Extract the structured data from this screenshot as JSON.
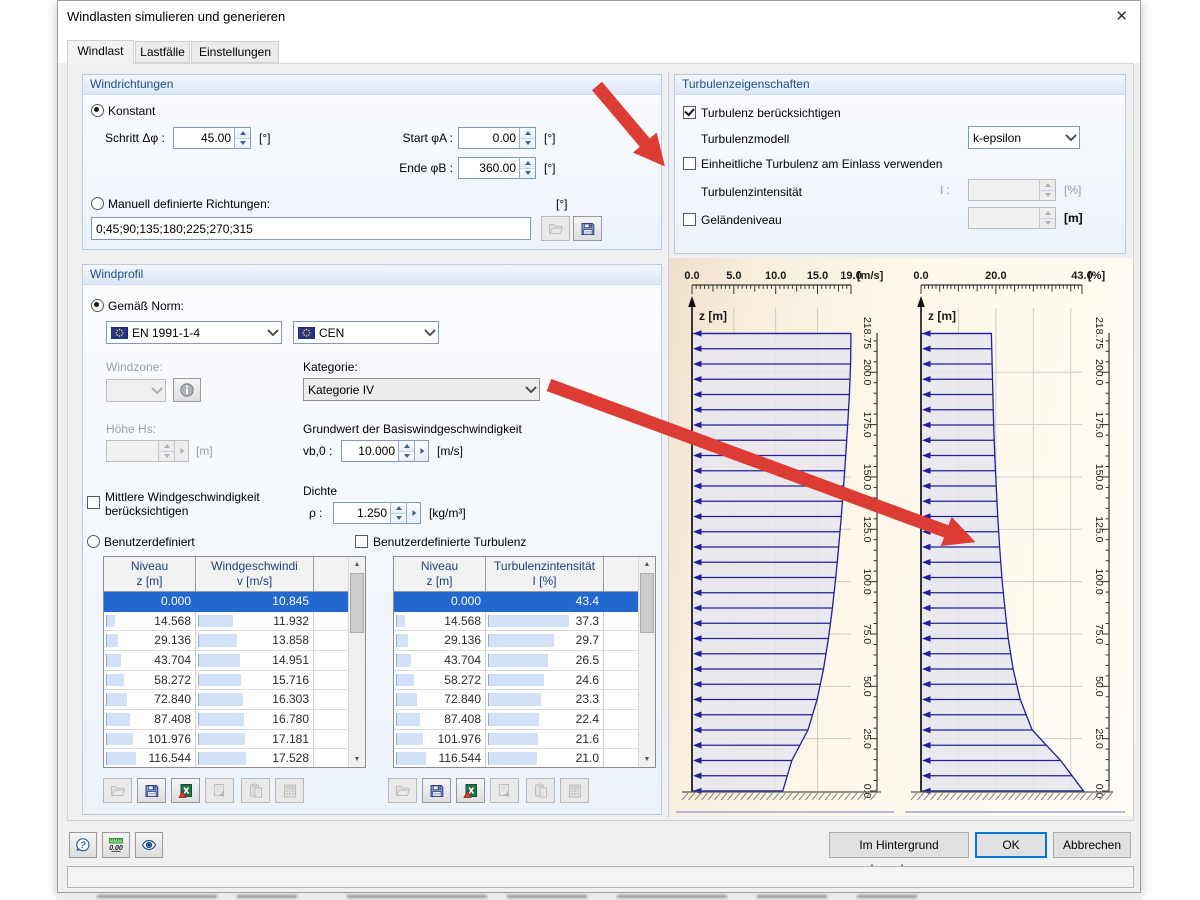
{
  "window": {
    "title": "Windlasten simulieren und generieren",
    "close_glyph": "✕"
  },
  "tabs": [
    {
      "label": "Windlast"
    },
    {
      "label": "Lastfälle"
    },
    {
      "label": "Einstellungen"
    }
  ],
  "wind_directions": {
    "title": "Windrichtungen",
    "konstant": "Konstant",
    "schritt_label": "Schritt Δφ :",
    "schritt_value": "45.00",
    "start_label": "Start φA :",
    "start_value": "0.00",
    "ende_label": "Ende φB :",
    "ende_value": "360.00",
    "deg_unit": "[°]",
    "manual_label": "Manuell definierte Richtungen:",
    "manual_value": "0;45;90;135;180;225;270;315"
  },
  "wind_profile": {
    "title": "Windprofil",
    "norm_radio": "Gemäß Norm:",
    "norm_value": "EN 1991-1-4",
    "annex_value": "CEN",
    "windzone_label": "Windzone:",
    "kategorie_label": "Kategorie:",
    "kategorie_value": "Kategorie IV",
    "hoehe_label": "Höhe Hs:",
    "m_unit": "[m]",
    "grundwert_label": "Grundwert der Basiswindgeschwindigkeit",
    "vb0_label": "vb,0 :",
    "vb0_value": "10.000",
    "ms_unit": "[m/s]",
    "dichte_label": "Dichte",
    "rho_label": "ρ :",
    "rho_value": "1.250",
    "kg_unit": "[kg/m³]",
    "mittlere_label_1": "Mittlere Windgeschwindigkeit",
    "mittlere_label_2": "berücksichtigen",
    "benutzerdefiniert": "Benutzerdefiniert",
    "benutzerdef_turbulenz": "Benutzerdefinierte Turbulenz"
  },
  "velocity_table": {
    "col1": [
      "Niveau",
      "z [m]"
    ],
    "col2": [
      "Windgeschwindi",
      "v [m/s]"
    ],
    "rows": [
      [
        "0.000",
        "10.845"
      ],
      [
        "14.568",
        "11.932"
      ],
      [
        "29.136",
        "13.858"
      ],
      [
        "43.704",
        "14.951"
      ],
      [
        "58.272",
        "15.716"
      ],
      [
        "72.840",
        "16.303"
      ],
      [
        "87.408",
        "16.780"
      ],
      [
        "101.976",
        "17.181"
      ],
      [
        "116.544",
        "17.528"
      ]
    ]
  },
  "turbulence_table": {
    "col1": [
      "Niveau",
      "z [m]"
    ],
    "col2": [
      "Turbulenzintensität",
      "I [%]"
    ],
    "rows": [
      [
        "0.000",
        "43.4"
      ],
      [
        "14.568",
        "37.3"
      ],
      [
        "29.136",
        "29.7"
      ],
      [
        "43.704",
        "26.5"
      ],
      [
        "58.272",
        "24.6"
      ],
      [
        "72.840",
        "23.3"
      ],
      [
        "87.408",
        "22.4"
      ],
      [
        "101.976",
        "21.6"
      ],
      [
        "116.544",
        "21.0"
      ]
    ]
  },
  "turbulence_props": {
    "title": "Turbulenzeigenschaften",
    "consider": "Turbulenz berücksichtigen",
    "model_label": "Turbulenzmodell",
    "model_value": "k-epsilon",
    "uniform": "Einheitliche Turbulenz am Einlass verwenden",
    "intensity_label": "Turbulenzintensität",
    "i_label": "I :",
    "percent_unit": "[%]",
    "ground_label": "Geländeniveau",
    "m_unit": "[m]"
  },
  "footer": {
    "background": "Im Hintergrund berechnen",
    "ok": "OK",
    "cancel": "Abbrechen"
  },
  "colors": {
    "selection": "#2268cf",
    "group_title": "#1f4e8c",
    "annotation_arrow": "#dd3c34",
    "profile_stroke": "#20209a",
    "table_bar": "#d3e1f8"
  },
  "chart_data": [
    {
      "type": "area",
      "name": "wind-velocity-profile",
      "x_unit": "[m/s]",
      "x_ticks": [
        0,
        5,
        10,
        15,
        19
      ],
      "x_tick_labels": [
        "0.0",
        "5.0",
        "10.0",
        "15.0",
        "19.0"
      ],
      "xlim": [
        0,
        19
      ],
      "x_grid": [
        5,
        10,
        15
      ],
      "y_axis_label": "z [m]",
      "y_ticks": [
        218.75,
        200,
        175,
        150,
        125,
        100,
        75,
        50,
        25,
        0
      ],
      "y_tick_labels": [
        "218.75",
        "200.0",
        "175.0",
        "150.0",
        "125.0",
        "100.0",
        "75.0",
        "50.0",
        "25.0",
        "0.0"
      ],
      "ylim": [
        0,
        218.75
      ],
      "grid": true,
      "z": [
        0,
        14.568,
        29.136,
        43.704,
        58.272,
        72.84,
        87.408,
        101.976,
        116.544,
        131.112,
        145.68,
        160.248,
        174.816,
        189.384,
        203.952,
        218.52
      ],
      "values": [
        10.845,
        11.932,
        13.858,
        14.951,
        15.716,
        16.303,
        16.78,
        17.181,
        17.528,
        17.84,
        18.12,
        18.37,
        18.6,
        18.81,
        18.95,
        19.0
      ]
    },
    {
      "type": "area",
      "name": "turbulence-intensity-profile",
      "x_unit": "[%]",
      "x_ticks": [
        0,
        20,
        43
      ],
      "x_tick_labels": [
        "0.0",
        "20.0",
        "43.0"
      ],
      "xlim": [
        0,
        43
      ],
      "x_grid": [
        10,
        20,
        30,
        40
      ],
      "y_axis_label": "z [m]",
      "y_ticks": [
        218.75,
        200,
        175,
        150,
        125,
        100,
        75,
        50,
        25,
        0
      ],
      "y_tick_labels": [
        "218.75",
        "200.0",
        "175.0",
        "150.0",
        "125.0",
        "100.0",
        "75.0",
        "50.0",
        "25.0",
        "0.0"
      ],
      "ylim": [
        0,
        218.75
      ],
      "grid": true,
      "z": [
        0,
        14.568,
        29.136,
        43.704,
        58.272,
        72.84,
        87.408,
        101.976,
        116.544,
        131.112,
        145.68,
        160.248,
        174.816,
        189.384,
        203.952,
        218.52
      ],
      "values": [
        43.4,
        37.3,
        29.7,
        26.5,
        24.6,
        23.3,
        22.4,
        21.6,
        21.0,
        20.5,
        20.1,
        19.7,
        19.4,
        19.2,
        19.0,
        18.8
      ]
    }
  ]
}
